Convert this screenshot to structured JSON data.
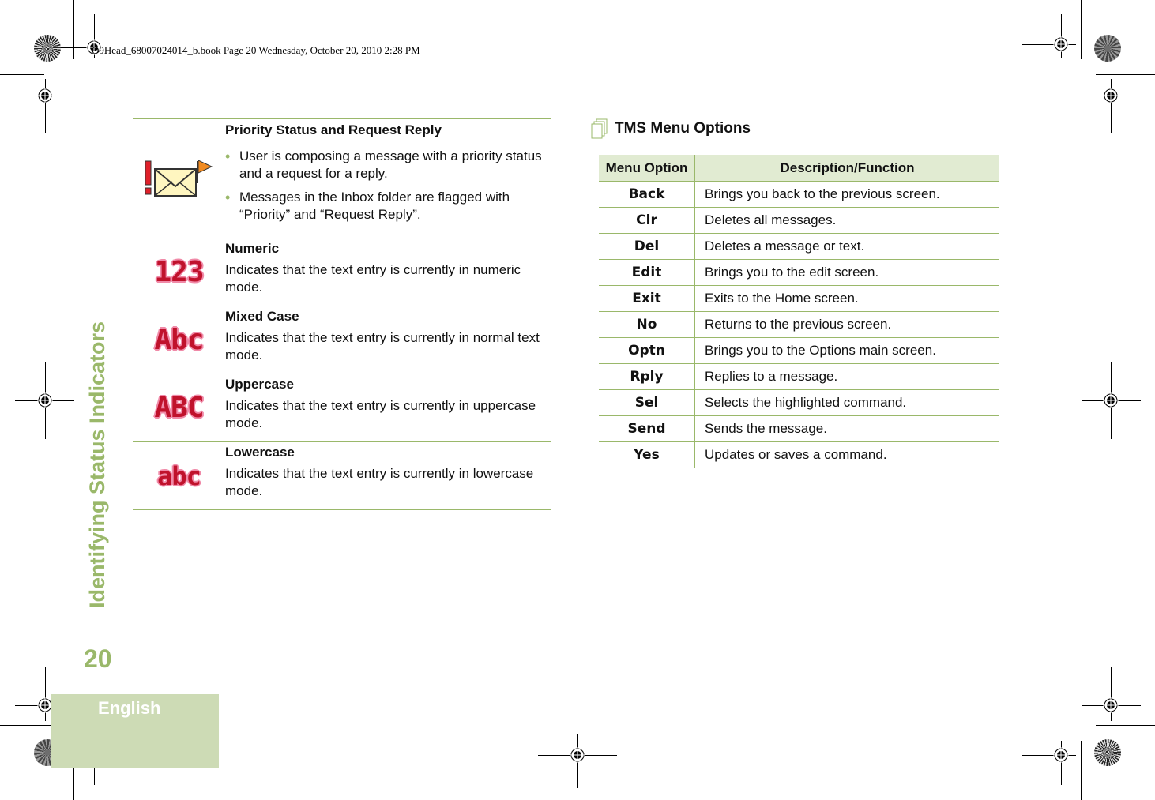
{
  "header_slug": "O9Head_68007024014_b.book  Page 20  Wednesday, October 20, 2010  2:28 PM",
  "side_tab": {
    "section_title": "Identifying Status Indicators",
    "page_number": "20",
    "language": "English"
  },
  "indicators": [
    {
      "icon": "priority-request-reply-icon",
      "title": "Priority Status and Request Reply",
      "bullets": [
        "User is composing a message with a priority status and a request for a reply.",
        "Messages in the Inbox folder are flagged with “Priority” and “Request Reply”."
      ]
    },
    {
      "icon": "numeric-mode-icon",
      "glyph": "123",
      "title": "Numeric",
      "description": "Indicates that the text entry is currently in numeric mode."
    },
    {
      "icon": "mixed-case-mode-icon",
      "glyph": "Abc",
      "title": "Mixed Case",
      "description": "Indicates that the text entry is currently in normal text mode."
    },
    {
      "icon": "uppercase-mode-icon",
      "glyph": "ABC",
      "title": "Uppercase",
      "description": "Indicates that the text entry is currently in uppercase mode."
    },
    {
      "icon": "lowercase-mode-icon",
      "glyph": "abc",
      "title": "Lowercase",
      "description": "Indicates that the text entry is currently in lowercase mode."
    }
  ],
  "tms_menu": {
    "heading": "TMS Menu Options",
    "columns": [
      "Menu Option",
      "Description/Function"
    ],
    "rows": [
      {
        "option": "Back",
        "description": "Brings you back to the previous screen."
      },
      {
        "option": "Clr",
        "description": "Deletes all messages."
      },
      {
        "option": "Del",
        "description": "Deletes a message or text."
      },
      {
        "option": "Edit",
        "description": "Brings you to the edit screen."
      },
      {
        "option": "Exit",
        "description": "Exits to the Home screen."
      },
      {
        "option": "No",
        "description": "Returns to the previous screen."
      },
      {
        "option": "Optn",
        "description": "Brings you to the Options main screen."
      },
      {
        "option": "Rply",
        "description": "Replies to a message."
      },
      {
        "option": "Sel",
        "description": "Selects the highlighted command."
      },
      {
        "option": "Send",
        "description": "Sends the message."
      },
      {
        "option": "Yes",
        "description": "Updates or saves a command."
      }
    ]
  },
  "colors": {
    "accent_green": "#9ab86a",
    "tab_background": "#cddbb5",
    "table_header_bg": "#e1ebd2",
    "indicator_red": "#c0122c",
    "indicator_pink": "#f08aa8"
  }
}
